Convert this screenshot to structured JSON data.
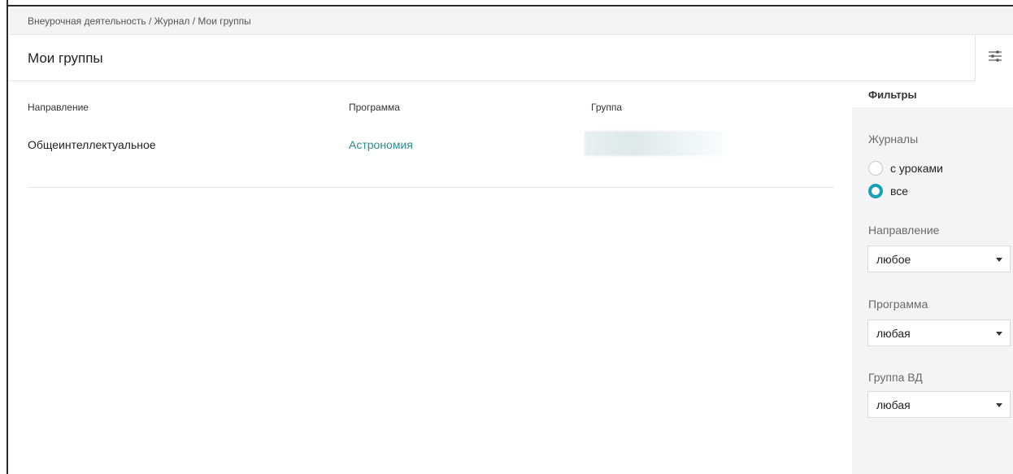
{
  "breadcrumb": "Внеурочная деятельность / Журнал / Мои группы",
  "page_title": "Мои группы",
  "table": {
    "headers": [
      "Направление",
      "Программа",
      "Группа"
    ],
    "rows": [
      {
        "direction": "Общеинтеллектуальное",
        "program": "Астрономия",
        "group": ""
      }
    ]
  },
  "filters": {
    "title": "Фильтры",
    "journals": {
      "label": "Журналы",
      "options": [
        "с уроками",
        "все"
      ],
      "selected": "все"
    },
    "direction": {
      "label": "Направление",
      "value": "любое"
    },
    "program": {
      "label": "Программа",
      "value": "любая"
    },
    "group_vd": {
      "label": "Группа ВД",
      "value": "любая"
    }
  },
  "icons": {
    "filter_toggle": "sliders-icon"
  },
  "colors": {
    "accent": "#1aa0b5",
    "link": "#2a8a8e"
  }
}
